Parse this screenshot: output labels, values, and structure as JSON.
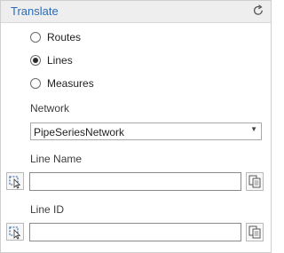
{
  "header": {
    "title": "Translate",
    "refresh_icon": "refresh-icon"
  },
  "translate_type": {
    "options": [
      {
        "label": "Routes",
        "checked": false
      },
      {
        "label": "Lines",
        "checked": true
      },
      {
        "label": "Measures",
        "checked": false
      }
    ]
  },
  "network": {
    "label": "Network",
    "value": "PipeSeriesNetwork",
    "caret_icon": "dropdown-caret-icon"
  },
  "line_name": {
    "label": "Line Name",
    "value": "",
    "placeholder": "",
    "picker_icon": "select-features-icon",
    "copy_icon": "copy-icon"
  },
  "line_id": {
    "label": "Line ID",
    "value": "",
    "placeholder": "",
    "picker_icon": "select-features-icon",
    "copy_icon": "copy-icon"
  }
}
